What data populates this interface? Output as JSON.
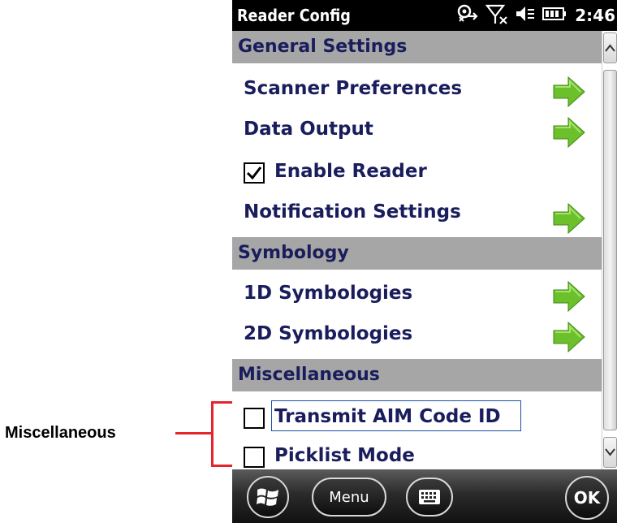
{
  "callout": {
    "label": "Miscellaneous",
    "color": "#e2262c"
  },
  "status_bar": {
    "title": "Reader Config",
    "time": "2:46",
    "icons": [
      "connectivity-icon",
      "no-signal-icon",
      "volume-off-icon",
      "battery-icon"
    ]
  },
  "sections": [
    {
      "header": "General Settings",
      "items": [
        {
          "label": "Scanner Preferences",
          "type": "link",
          "icon": "green-arrow-icon"
        },
        {
          "label": "Data Output",
          "type": "link",
          "icon": "green-arrow-icon"
        },
        {
          "label": "Enable Reader",
          "type": "checkbox",
          "checked": true
        },
        {
          "label": "Notification Settings",
          "type": "link",
          "icon": "green-arrow-icon"
        }
      ]
    },
    {
      "header": "Symbology",
      "items": [
        {
          "label": "1D Symbologies",
          "type": "link",
          "icon": "green-arrow-icon"
        },
        {
          "label": "2D Symbologies",
          "type": "link",
          "icon": "green-arrow-icon"
        }
      ]
    },
    {
      "header": "Miscellaneous",
      "items": [
        {
          "label": "Transmit AIM Code ID",
          "type": "checkbox",
          "checked": false,
          "focused": true
        },
        {
          "label": "Picklist Mode",
          "type": "checkbox",
          "checked": false
        }
      ]
    }
  ],
  "bottom_bar": {
    "menu_label": "Menu",
    "ok_label": "OK"
  },
  "colors": {
    "header_bg": "#a6a6a6",
    "text": "#1a1d5c",
    "arrow": "#6cc02b"
  }
}
